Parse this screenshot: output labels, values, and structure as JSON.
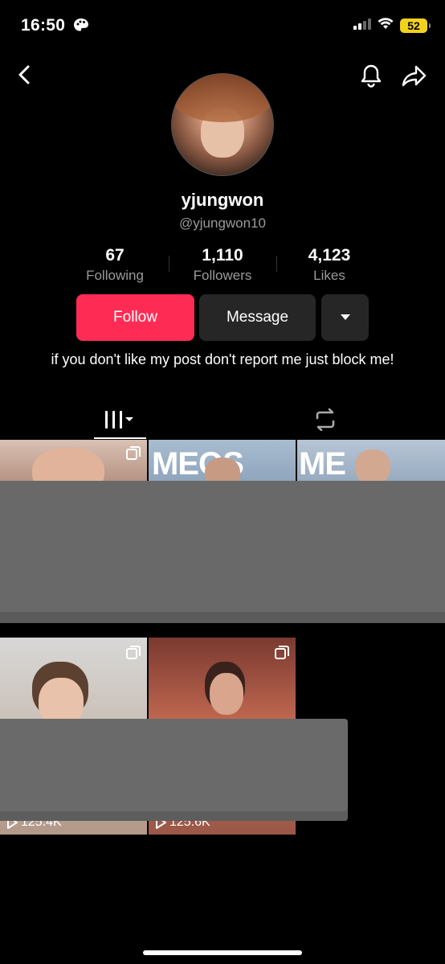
{
  "status_bar": {
    "time": "16:50",
    "battery": "52"
  },
  "profile": {
    "username": "yjungwon",
    "handle": "@yjungwon10",
    "bio": "if you don't like my post don't report me just block me!"
  },
  "stats": [
    {
      "value": "67",
      "label": "Following"
    },
    {
      "value": "1,110",
      "label": "Followers"
    },
    {
      "value": "4,123",
      "label": "Likes"
    }
  ],
  "actions": {
    "follow_label": "Follow",
    "message_label": "Message"
  },
  "tabs": [
    {
      "name": "videos",
      "icon": "grid-columns-icon"
    },
    {
      "name": "reposts",
      "icon": "repost-icon"
    }
  ],
  "videos": [
    {
      "views": "",
      "multi": true
    },
    {
      "views": "",
      "multi": false,
      "overlay_text": "MEOS"
    },
    {
      "views": "",
      "multi": false,
      "overlay_text": "ME"
    },
    {
      "views": "125.4K",
      "multi": true
    },
    {
      "views": "125.6K",
      "multi": true
    }
  ],
  "colors": {
    "accent": "#fe2c55",
    "background": "#000000",
    "secondary_button": "#262626",
    "muted_text": "#9a9a9a"
  }
}
